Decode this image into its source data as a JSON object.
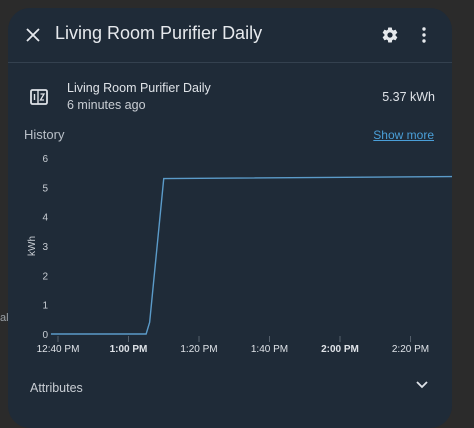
{
  "backdrop": {
    "edge_text": "al"
  },
  "dialog": {
    "title": "Living Room Purifier Daily",
    "icons": {
      "close": "close-icon",
      "settings": "gear-icon",
      "more": "dots-vertical-icon"
    }
  },
  "entity": {
    "name": "Living Room Purifier Daily",
    "last_changed": "6 minutes ago",
    "state": "5.37 kWh",
    "icon": "counter-icon"
  },
  "history": {
    "label": "History",
    "show_more": "Show more"
  },
  "attributes": {
    "label": "Attributes",
    "icon": "chevron-down-icon"
  },
  "colors": {
    "accent": "#4a9fd8",
    "line": "#5b9bc9",
    "surface": "#1f2b38"
  },
  "chart_data": {
    "type": "line",
    "ylabel": "kWh",
    "ylim": [
      0,
      6
    ],
    "yticks": [
      "0",
      "1",
      "2",
      "3",
      "4",
      "5",
      "6"
    ],
    "x_ticks": [
      {
        "label": "12:40 PM",
        "bold": false
      },
      {
        "label": "1:00 PM",
        "bold": true
      },
      {
        "label": "1:20 PM",
        "bold": false
      },
      {
        "label": "1:40 PM",
        "bold": false
      },
      {
        "label": "2:00 PM",
        "bold": true
      },
      {
        "label": "2:20 PM",
        "bold": false
      }
    ],
    "series": [
      {
        "points": [
          [
            "12:38 PM",
            0
          ],
          [
            "1:05 PM",
            0
          ],
          [
            "1:06 PM",
            0.4
          ],
          [
            "1:10 PM",
            5.3
          ],
          [
            "2:35 PM",
            5.37
          ]
        ]
      }
    ],
    "grid": false
  }
}
